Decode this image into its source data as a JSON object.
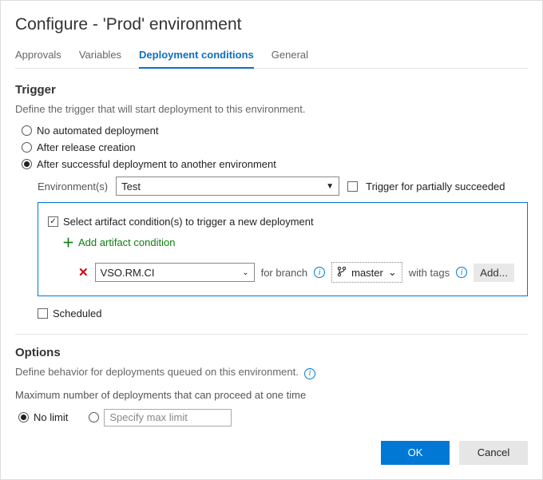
{
  "title": "Configure - 'Prod' environment",
  "tabs": {
    "approvals": "Approvals",
    "variables": "Variables",
    "deployment_conditions": "Deployment conditions",
    "general": "General"
  },
  "trigger": {
    "header": "Trigger",
    "desc": "Define the trigger that will start deployment to this environment.",
    "opt_no_auto": "No automated deployment",
    "opt_after_release": "After release creation",
    "opt_after_success": "After successful deployment to another environment",
    "env_label": "Environment(s)",
    "env_value": "Test",
    "trigger_partial": "Trigger for partially succeeded",
    "artifact": {
      "select_label": "Select artifact condition(s) to trigger a new deployment",
      "add_label": "Add artifact condition",
      "source_value": "VSO.RM.CI",
      "for_branch": "for branch",
      "branch_value": "master",
      "with_tags": "with tags",
      "add_btn": "Add..."
    },
    "scheduled": "Scheduled"
  },
  "options": {
    "header": "Options",
    "desc": "Define behavior for deployments queued on this environment.",
    "max_label": "Maximum number of deployments that can proceed at one time",
    "no_limit": "No limit",
    "specify_placeholder": "Specify max limit"
  },
  "buttons": {
    "ok": "OK",
    "cancel": "Cancel"
  }
}
